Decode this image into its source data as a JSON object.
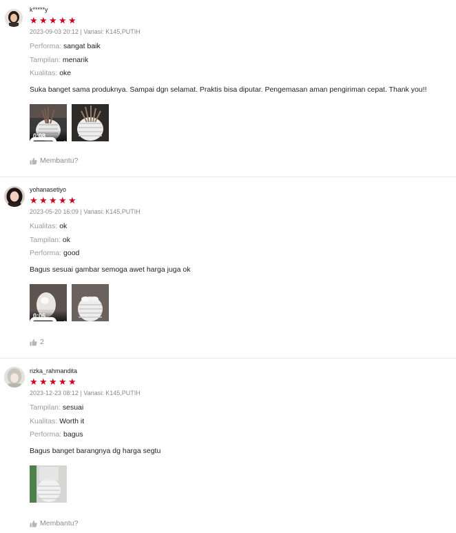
{
  "reviews": [
    {
      "username": "k*****y",
      "rating": 5,
      "meta": "2023-09-03 20:12 | Variasi: K145,PUTIH",
      "attributes": [
        {
          "key": "Performa:",
          "value": "sangat baik"
        },
        {
          "key": "Tampilan:",
          "value": "menarik"
        },
        {
          "key": "Kualitas:",
          "value": "oke"
        }
      ],
      "text": "Suka banget sama produknya. Sampai dgn selamat. Praktis bisa diputar. Pengemasan aman pengiriman cepat. Thank you!!",
      "media": [
        {
          "type": "video",
          "duration": "0:08"
        },
        {
          "type": "image"
        }
      ],
      "helpful_label": "Membantu?"
    },
    {
      "username": "yohanasetiyo",
      "rating": 5,
      "meta": "2023-05-20 16:09 | Variasi: K145,PUTIH",
      "attributes": [
        {
          "key": "Kualitas:",
          "value": "ok"
        },
        {
          "key": "Tampilan:",
          "value": "ok"
        },
        {
          "key": "Performa:",
          "value": "good"
        }
      ],
      "text": "Bagus sesuai gambar semoga awet harga juga ok",
      "media": [
        {
          "type": "video",
          "duration": "0:06"
        },
        {
          "type": "image"
        }
      ],
      "helpful_label": "2"
    },
    {
      "username": "rizka_rahmandita",
      "rating": 5,
      "meta": "2023-12-23 08:12 | Variasi: K145,PUTIH",
      "attributes": [
        {
          "key": "Tampilan:",
          "value": "sesuai"
        },
        {
          "key": "Kualitas:",
          "value": "Worth it"
        },
        {
          "key": "Performa:",
          "value": "bagus"
        }
      ],
      "text": "Bagus banget barangnya dg harga segtu",
      "media": [
        {
          "type": "image"
        }
      ],
      "helpful_label": "Membantu?"
    }
  ],
  "icons": {
    "star": "star-icon",
    "helpful": "thumbs-up-icon",
    "video": "video-camera-icon"
  },
  "colors": {
    "star": "#d0021b",
    "muted": "#9b9b9b"
  }
}
